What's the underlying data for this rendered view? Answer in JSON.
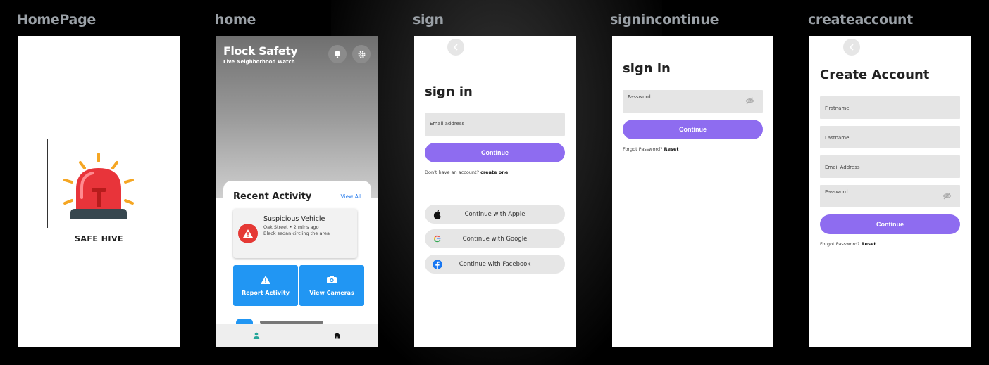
{
  "frames": {
    "homepage": {
      "label": "HomePage",
      "app_name": "SAFE HIVE"
    },
    "home": {
      "label": "home",
      "title": "Flock Safety",
      "subtitle": "Live Neighborhood Watch",
      "recent_title": "Recent Activity",
      "view_all": "View All",
      "alert": {
        "title": "Suspicious Vehicle",
        "meta": "Oak Street • 2 mins ago",
        "desc": "Black sedan circling the area"
      },
      "tiles": [
        {
          "label": "Report Activity",
          "icon": "warning-icon"
        },
        {
          "label": "View Cameras",
          "icon": "camera-icon"
        }
      ],
      "nav": [
        {
          "icon": "person-icon"
        },
        {
          "icon": "home-icon"
        }
      ],
      "accent": "#2196f3"
    },
    "sign": {
      "label": "sign",
      "title": "sign in",
      "email_label": "Email address",
      "continue": "Continue",
      "no_account": "Don't have an account?",
      "create_link": "create one",
      "social": [
        {
          "label": "Continue with Apple",
          "icon": "apple-icon"
        },
        {
          "label": "Continue with Google",
          "icon": "google-icon"
        },
        {
          "label": "Continue with Facebook",
          "icon": "facebook-icon"
        }
      ]
    },
    "signincontinue": {
      "label": "signincontinue",
      "title": "sign in",
      "password_label": "Password",
      "continue": "Continue",
      "forgot": "Forgot Password?",
      "reset": "Reset"
    },
    "createaccount": {
      "label": "createaccount",
      "title": "Create Account",
      "fields": [
        "Firstname",
        "Lastname",
        "Email Address",
        "Password"
      ],
      "continue": "Continue",
      "forgot": "Forgot Password?",
      "reset": "Reset"
    }
  },
  "colors": {
    "primary": "#8e6cf0",
    "danger": "#e53935",
    "siren": "#e8343a",
    "siren_rays": "#f5a623"
  }
}
